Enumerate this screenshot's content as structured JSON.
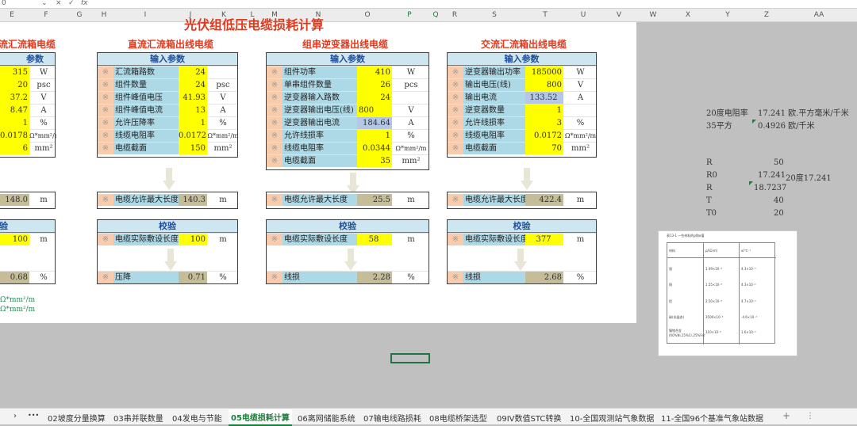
{
  "formula_bar": {
    "name_box": "0",
    "check_label": "✓",
    "cancel_label": "×",
    "fx_label": "fx"
  },
  "columns": [
    "E",
    "F",
    "G",
    "H",
    "I",
    "J",
    "K",
    "L",
    "M",
    "N",
    "O",
    "P",
    "Q",
    "R",
    "S",
    "T",
    "U",
    "V",
    "W",
    "X",
    "Y",
    "Z",
    "AA"
  ],
  "sheet_title_partial": "光伏组低压电缆损耗计算",
  "panel1": {
    "title": "流汇流箱电缆",
    "header": "参数",
    "rows": [
      {
        "value": "315",
        "unit": "W"
      },
      {
        "value": "20",
        "unit": "psc"
      },
      {
        "value": "37.2",
        "unit": "V"
      },
      {
        "value": "8.47",
        "unit": "A"
      },
      {
        "value": "1",
        "unit": "%"
      },
      {
        "value": "0.0178",
        "unit": "Ω*mm²/m"
      },
      {
        "value": "6",
        "unit": "mm²"
      }
    ],
    "result_value": "148.0",
    "result_unit": "m",
    "check_header": "验",
    "check_value": "100",
    "check_unit": "m",
    "final_value": "0.68",
    "final_unit": "%",
    "note1": "Ω*mm²/m",
    "note2": "Ω*mm²/m"
  },
  "panel2": {
    "title": "直流汇流箱出线电缆",
    "header": "输入参数",
    "rows": [
      {
        "label": "汇流箱路数",
        "value": "24",
        "unit": ""
      },
      {
        "label": "组件数量",
        "value": "24",
        "unit": "psc"
      },
      {
        "label": "组件峰值电压",
        "value": "41.93",
        "unit": "V"
      },
      {
        "label": "组件峰值电流",
        "value": "13",
        "unit": "A"
      },
      {
        "label": "允许压降率",
        "value": "1",
        "unit": "%"
      },
      {
        "label": "线缆电阻率",
        "value": "0.0172",
        "unit": "Ω*mm²/m"
      },
      {
        "label": "电缆截面",
        "value": "150",
        "unit": "mm²"
      }
    ],
    "result_label": "电缆允许最大长度",
    "result_value": "140.3",
    "result_unit": "m",
    "check_header": "校验",
    "check_label": "电缆实际敷设长度",
    "check_value": "100",
    "check_unit": "m",
    "final_label": "压降",
    "final_value": "0.71",
    "final_unit": "%"
  },
  "panel3": {
    "title": "组串逆变器出线电缆",
    "header": "输入参数",
    "rows": [
      {
        "label": "组件功率",
        "value": "410",
        "unit": "W"
      },
      {
        "label": "单串组件数量",
        "value": "26",
        "unit": "pcs"
      },
      {
        "label": "逆变器输入路数",
        "value": "24",
        "unit": ""
      },
      {
        "label": "逆变器输出电压(线)",
        "value": "800",
        "unit": "V"
      },
      {
        "label": "逆变器输出电流",
        "value": "184.64",
        "unit": "A"
      },
      {
        "label": "允许线损率",
        "value": "1",
        "unit": "%"
      },
      {
        "label": "线缆电阻率",
        "value": "0.0344",
        "unit": "Ω*mm²/m"
      },
      {
        "label": "电缆截面",
        "value": "35",
        "unit": "mm²"
      }
    ],
    "result_label": "电缆允许最大长度",
    "result_value": "25.5",
    "result_unit": "m",
    "check_header": "校验",
    "check_label": "电缆实际敷设长度",
    "check_value": "58",
    "check_unit": "m",
    "final_label": "线损",
    "final_value": "2.28",
    "final_unit": "%"
  },
  "panel4": {
    "title": "交流汇流箱出线电缆",
    "header": "输入参数",
    "rows": [
      {
        "label": "逆变器输出功率",
        "value": "185000",
        "unit": "W"
      },
      {
        "label": "输出电压(线)",
        "value": "800",
        "unit": "V"
      },
      {
        "label": "输出电流",
        "value": "133.52",
        "unit": "A"
      },
      {
        "label": "逆变器数量",
        "value": "1",
        "unit": ""
      },
      {
        "label": "允许线损率",
        "value": "3",
        "unit": "%"
      },
      {
        "label": "线缆电阻率",
        "value": "0.0172",
        "unit": "Ω*mm²/m"
      },
      {
        "label": "电缆截面",
        "value": "70",
        "unit": "mm²"
      }
    ],
    "result_label": "电缆允许最大长度",
    "result_value": "422.4",
    "result_unit": "m",
    "check_header": "校验",
    "check_label": "电缆实际敷设长度",
    "check_value": "377",
    "check_unit": "m",
    "final_label": "线损",
    "final_value": "2.68",
    "final_unit": "%"
  },
  "right_notes": {
    "line1_label": "20度电阻率",
    "line1_value": "17.241 欧.平方毫米/千米",
    "line2_label": "35平方",
    "line2_value": "0.4926 欧/千米",
    "r_label": "R",
    "r_value": "50",
    "r0_label": "R0",
    "r0_value": "17.241",
    "r0_note": "20度17.241",
    "r2_label": "R",
    "r2_value": "18.7237",
    "t_label": "T",
    "t_value": "40",
    "t0_label": "T0",
    "t0_value": "20"
  },
  "pic_table": {
    "caption": "表13-1 一些材料的ρ和α值",
    "headers": [
      "材料",
      "ρ/(Ω·m)",
      "α/℃⁻¹"
    ],
    "rows": [
      [
        "银",
        "1.49×10⁻⁸",
        "4.3×10⁻³"
      ],
      [
        "铜",
        "1.55×10⁻⁸",
        "4.3×10⁻³"
      ],
      [
        "铝",
        "2.50×10⁻⁸",
        "4.7×10⁻³"
      ],
      [
        "碳(非晶态)",
        "3500×10⁻⁸",
        "-4.6×10⁻⁴"
      ],
      [
        "镍铬合金\n(60%Ni,15%Cr,25%Fe)",
        "110×10⁻⁸",
        "1.6×10⁻⁴"
      ]
    ]
  },
  "tabs": [
    "02坡度分量换算",
    "03串并联数量",
    "04发电与节能",
    "05电缆损耗计算",
    "06离网储能系统",
    "07输电线路损耗",
    "08电缆桥架选型",
    "09IV数值STC转换",
    "10-全国观测站气象数据",
    "11-全国96个基准气象站数据"
  ],
  "active_tab": "05电缆损耗计算",
  "add_sheet_label": "+",
  "more_tabs_label": "•••"
}
